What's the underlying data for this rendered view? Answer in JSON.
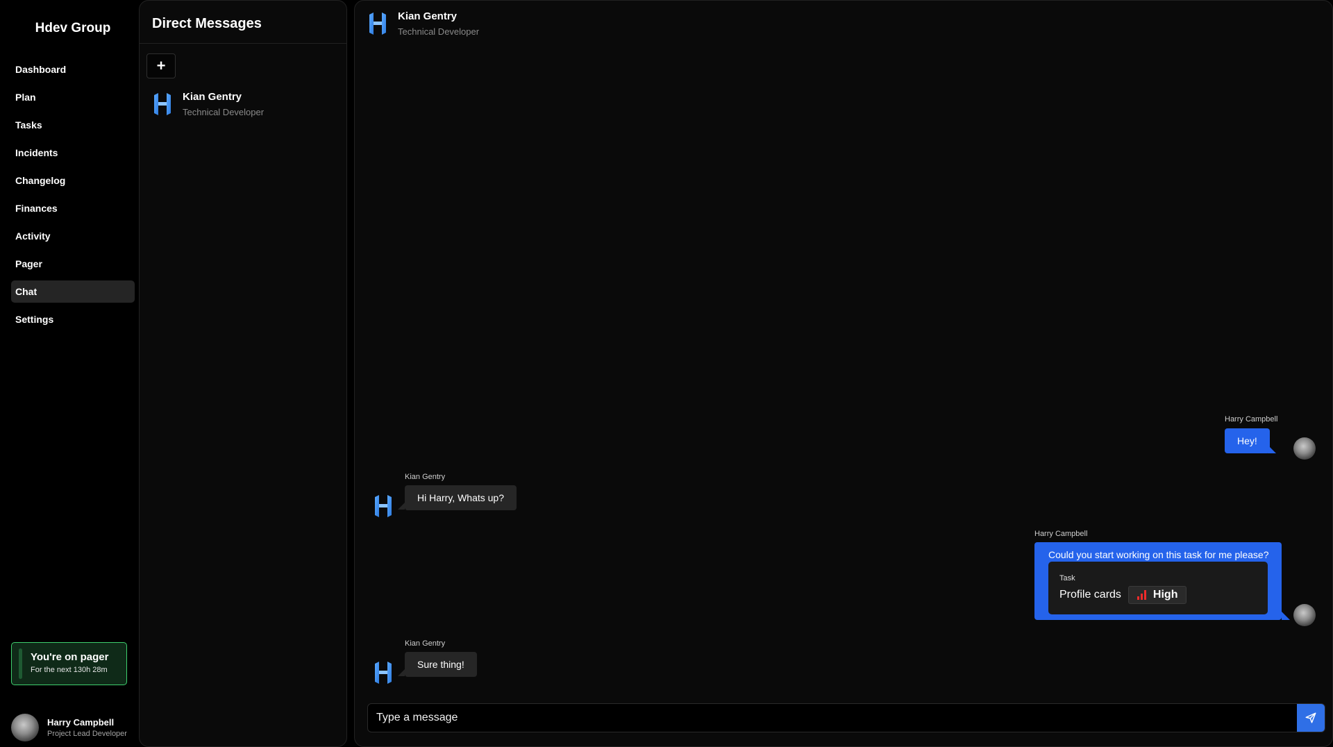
{
  "app": {
    "brand": "Hdev Group"
  },
  "sidebar": {
    "items": [
      {
        "label": "Dashboard",
        "active": false
      },
      {
        "label": "Plan",
        "active": false
      },
      {
        "label": "Tasks",
        "active": false
      },
      {
        "label": "Incidents",
        "active": false
      },
      {
        "label": "Changelog",
        "active": false
      },
      {
        "label": "Finances",
        "active": false
      },
      {
        "label": "Activity",
        "active": false
      },
      {
        "label": "Pager",
        "active": false
      },
      {
        "label": "Chat",
        "active": true
      },
      {
        "label": "Settings",
        "active": false
      }
    ],
    "pager": {
      "title": "You're on pager",
      "subtitle": "For the next 130h 28m",
      "color": "#3ecf6e"
    },
    "user": {
      "name": "Harry Campbell",
      "role": "Project Lead Developer"
    }
  },
  "dm": {
    "title": "Direct Messages",
    "add_label": "+",
    "contacts": [
      {
        "name": "Kian Gentry",
        "role": "Technical Developer",
        "icon": "h-logo-icon"
      }
    ]
  },
  "chat": {
    "header": {
      "name": "Kian Gentry",
      "role": "Technical Developer"
    },
    "messages": [
      {
        "sender": "Harry Campbell",
        "text": "Hey!",
        "direction": "out"
      },
      {
        "sender": "Kian Gentry",
        "text": "Hi Harry, Whats up?",
        "direction": "in"
      },
      {
        "sender": "Harry Campbell",
        "text": "Could you start working on this task for me please?",
        "direction": "out",
        "task": {
          "label": "Task",
          "name": "Profile cards",
          "priority": "High",
          "priority_color": "#ef2b2b"
        }
      },
      {
        "sender": "Kian Gentry",
        "text": "Sure thing!",
        "direction": "in"
      }
    ],
    "input": {
      "placeholder": "Type a message",
      "value": ""
    },
    "send_icon": "send-icon",
    "accent": "#2563eb"
  }
}
